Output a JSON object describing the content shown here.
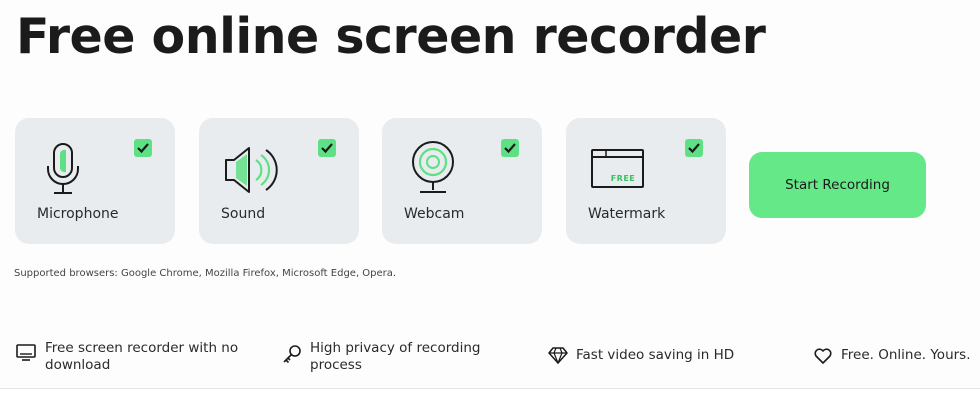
{
  "hero": {
    "title": "Free online screen recorder"
  },
  "options": [
    {
      "label": "Microphone",
      "icon": "microphone-icon",
      "checked": true
    },
    {
      "label": "Sound",
      "icon": "speaker-icon",
      "checked": true
    },
    {
      "label": "Webcam",
      "icon": "webcam-icon",
      "checked": true
    },
    {
      "label": "Watermark",
      "icon": "watermark-icon",
      "checked": true,
      "badge": "FREE"
    }
  ],
  "start_button": {
    "label": "Start Recording",
    "color": "#64e888"
  },
  "supported_note": "Supported browsers: Google Chrome, Mozilla Firefox, Microsoft Edge, Opera.",
  "features": [
    {
      "line1": "Free screen recorder with no",
      "line2": "download",
      "icon": "monitor-icon"
    },
    {
      "line1": "High privacy of recording",
      "line2": "process",
      "icon": "key-icon"
    },
    {
      "line1": "Fast video saving in HD",
      "icon": "diamond-icon"
    },
    {
      "line1": "Free. Online. Yours.",
      "icon": "heart-icon"
    }
  ],
  "colors": {
    "accent": "#5ee085",
    "card_bg": "#e8ecee",
    "text": "#1b1b1b"
  }
}
